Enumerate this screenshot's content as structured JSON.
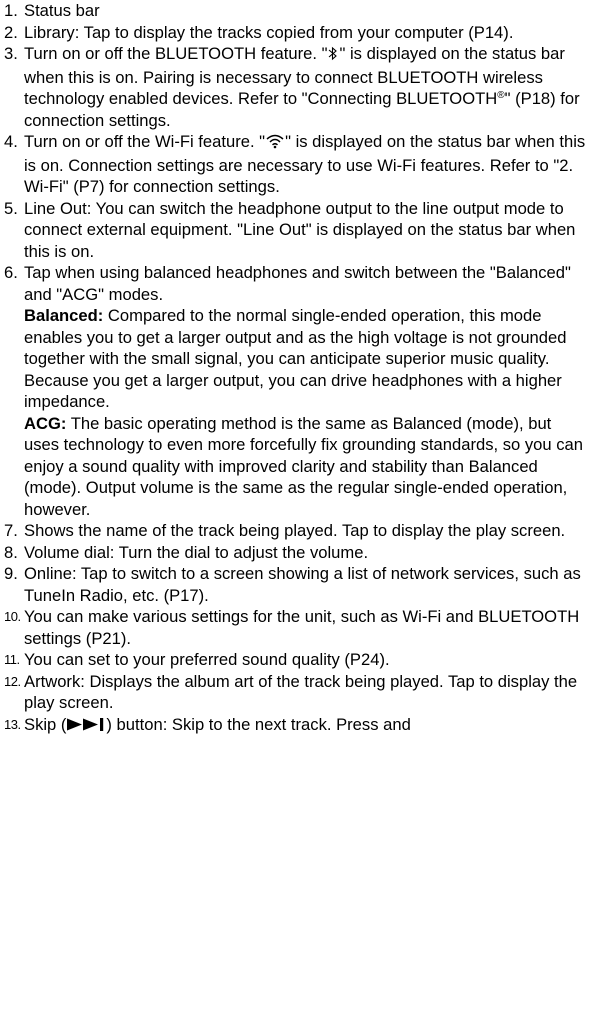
{
  "items": [
    {
      "num": "1.",
      "text": "Status bar"
    },
    {
      "num": "2.",
      "text": "Library: Tap to display the tracks copied from your computer (P14)."
    },
    {
      "num": "3.",
      "pre": "Turn on or off the BLUETOOTH feature. \"",
      "post": "\" is displayed on the status bar when this is on. Pairing is necessary to connect BLUETOOTH wireless technology enabled devices. Refer to \"Connecting BLUETOOTH",
      "sup": "®",
      "end": "\" (P18) for connection settings."
    },
    {
      "num": "4.",
      "pre": "Turn on or off the Wi-Fi feature. \"",
      "post": "\" is displayed on the status bar when this is on. Connection settings are necessary to use Wi-Fi features. Refer to \"2. Wi-Fi\" (P7) for connection settings."
    },
    {
      "num": "5.",
      "text": "Line Out: You can switch the headphone output to the line output mode to connect external equipment. \"Line Out\" is displayed on the status bar when this is on."
    },
    {
      "num": "6.",
      "text": "Tap when using balanced headphones and switch between the \"Balanced\" and \"ACG\" modes.",
      "balanced_term": "Balanced:",
      "balanced_text": " Compared to the normal single-ended operation, this mode enables you to get a larger output and as the high voltage is not grounded together with the small signal, you can anticipate superior music quality. Because you get a larger output, you can drive headphones with a higher impedance.",
      "acg_term": "ACG:",
      "acg_text": " The basic operating method is the same as Balanced (mode), but uses technology to even more forcefully fix grounding standards, so you can enjoy a sound quality with improved clarity and stability than Balanced (mode). Output volume is the same as the regular single-ended operation, however."
    },
    {
      "num": "7.",
      "text": "Shows the name of the track being played. Tap to display the play screen."
    },
    {
      "num": "8.",
      "text": "Volume dial: Turn the dial to adjust the volume."
    },
    {
      "num": "9.",
      "text": "Online: Tap to switch to a screen showing a list of network services, such as TuneIn Radio, etc. (P17)."
    },
    {
      "num": "10.",
      "text": "You can make various settings for the unit, such as Wi-Fi and BLUETOOTH settings (P21)."
    },
    {
      "num": "11.",
      "text": "You can set to your preferred sound quality (P24)."
    },
    {
      "num": "12.",
      "text": "Artwork: Displays the album art of the track being played. Tap to display the play screen."
    },
    {
      "num": "13.",
      "pre": "Skip (",
      "post": ") button: Skip to the next track. Press and"
    }
  ],
  "icons": {
    "bluetooth": "bluetooth-icon",
    "wifi": "wifi-icon",
    "skip": "skip-next-icon"
  }
}
